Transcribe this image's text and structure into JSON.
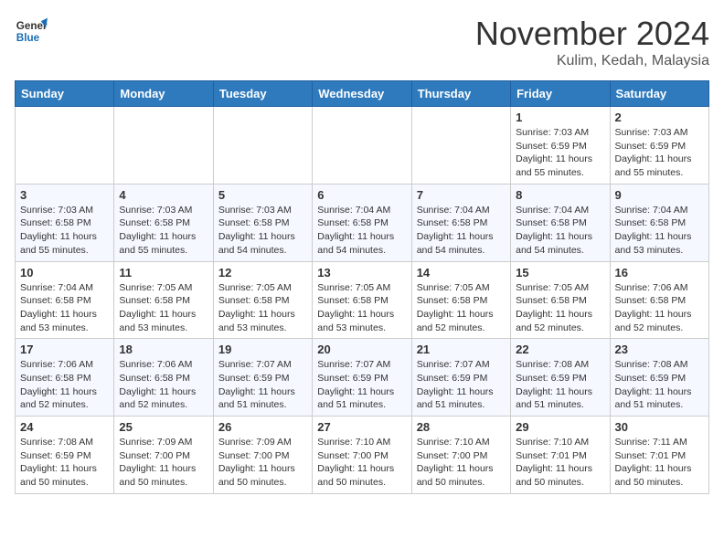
{
  "logo": {
    "general": "General",
    "blue": "Blue"
  },
  "title": "November 2024",
  "location": "Kulim, Kedah, Malaysia",
  "days_of_week": [
    "Sunday",
    "Monday",
    "Tuesday",
    "Wednesday",
    "Thursday",
    "Friday",
    "Saturday"
  ],
  "weeks": [
    [
      null,
      null,
      null,
      null,
      null,
      {
        "day": 1,
        "sunrise": "7:03 AM",
        "sunset": "6:59 PM",
        "daylight": "11 hours and 55 minutes."
      },
      {
        "day": 2,
        "sunrise": "7:03 AM",
        "sunset": "6:59 PM",
        "daylight": "11 hours and 55 minutes."
      }
    ],
    [
      {
        "day": 3,
        "sunrise": "7:03 AM",
        "sunset": "6:58 PM",
        "daylight": "11 hours and 55 minutes."
      },
      {
        "day": 4,
        "sunrise": "7:03 AM",
        "sunset": "6:58 PM",
        "daylight": "11 hours and 55 minutes."
      },
      {
        "day": 5,
        "sunrise": "7:03 AM",
        "sunset": "6:58 PM",
        "daylight": "11 hours and 54 minutes."
      },
      {
        "day": 6,
        "sunrise": "7:04 AM",
        "sunset": "6:58 PM",
        "daylight": "11 hours and 54 minutes."
      },
      {
        "day": 7,
        "sunrise": "7:04 AM",
        "sunset": "6:58 PM",
        "daylight": "11 hours and 54 minutes."
      },
      {
        "day": 8,
        "sunrise": "7:04 AM",
        "sunset": "6:58 PM",
        "daylight": "11 hours and 54 minutes."
      },
      {
        "day": 9,
        "sunrise": "7:04 AM",
        "sunset": "6:58 PM",
        "daylight": "11 hours and 53 minutes."
      }
    ],
    [
      {
        "day": 10,
        "sunrise": "7:04 AM",
        "sunset": "6:58 PM",
        "daylight": "11 hours and 53 minutes."
      },
      {
        "day": 11,
        "sunrise": "7:05 AM",
        "sunset": "6:58 PM",
        "daylight": "11 hours and 53 minutes."
      },
      {
        "day": 12,
        "sunrise": "7:05 AM",
        "sunset": "6:58 PM",
        "daylight": "11 hours and 53 minutes."
      },
      {
        "day": 13,
        "sunrise": "7:05 AM",
        "sunset": "6:58 PM",
        "daylight": "11 hours and 53 minutes."
      },
      {
        "day": 14,
        "sunrise": "7:05 AM",
        "sunset": "6:58 PM",
        "daylight": "11 hours and 52 minutes."
      },
      {
        "day": 15,
        "sunrise": "7:05 AM",
        "sunset": "6:58 PM",
        "daylight": "11 hours and 52 minutes."
      },
      {
        "day": 16,
        "sunrise": "7:06 AM",
        "sunset": "6:58 PM",
        "daylight": "11 hours and 52 minutes."
      }
    ],
    [
      {
        "day": 17,
        "sunrise": "7:06 AM",
        "sunset": "6:58 PM",
        "daylight": "11 hours and 52 minutes."
      },
      {
        "day": 18,
        "sunrise": "7:06 AM",
        "sunset": "6:58 PM",
        "daylight": "11 hours and 52 minutes."
      },
      {
        "day": 19,
        "sunrise": "7:07 AM",
        "sunset": "6:59 PM",
        "daylight": "11 hours and 51 minutes."
      },
      {
        "day": 20,
        "sunrise": "7:07 AM",
        "sunset": "6:59 PM",
        "daylight": "11 hours and 51 minutes."
      },
      {
        "day": 21,
        "sunrise": "7:07 AM",
        "sunset": "6:59 PM",
        "daylight": "11 hours and 51 minutes."
      },
      {
        "day": 22,
        "sunrise": "7:08 AM",
        "sunset": "6:59 PM",
        "daylight": "11 hours and 51 minutes."
      },
      {
        "day": 23,
        "sunrise": "7:08 AM",
        "sunset": "6:59 PM",
        "daylight": "11 hours and 51 minutes."
      }
    ],
    [
      {
        "day": 24,
        "sunrise": "7:08 AM",
        "sunset": "6:59 PM",
        "daylight": "11 hours and 50 minutes."
      },
      {
        "day": 25,
        "sunrise": "7:09 AM",
        "sunset": "7:00 PM",
        "daylight": "11 hours and 50 minutes."
      },
      {
        "day": 26,
        "sunrise": "7:09 AM",
        "sunset": "7:00 PM",
        "daylight": "11 hours and 50 minutes."
      },
      {
        "day": 27,
        "sunrise": "7:10 AM",
        "sunset": "7:00 PM",
        "daylight": "11 hours and 50 minutes."
      },
      {
        "day": 28,
        "sunrise": "7:10 AM",
        "sunset": "7:00 PM",
        "daylight": "11 hours and 50 minutes."
      },
      {
        "day": 29,
        "sunrise": "7:10 AM",
        "sunset": "7:01 PM",
        "daylight": "11 hours and 50 minutes."
      },
      {
        "day": 30,
        "sunrise": "7:11 AM",
        "sunset": "7:01 PM",
        "daylight": "11 hours and 50 minutes."
      }
    ]
  ]
}
